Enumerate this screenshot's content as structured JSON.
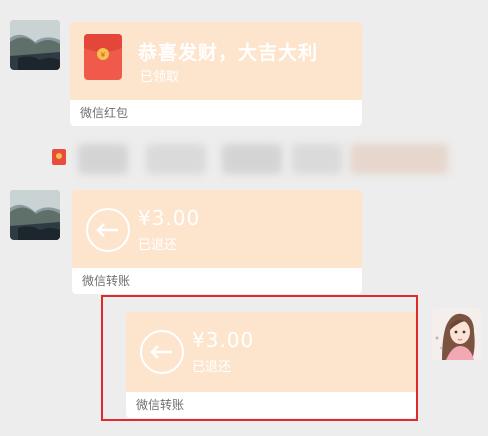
{
  "chat": {
    "red_packet": {
      "title": "恭喜发财，大吉大利",
      "status": "已领取",
      "footer": "微信红包",
      "icon": "red-packet-icon"
    },
    "transfer_received_back": {
      "amount": "¥3.00",
      "status": "已退还",
      "footer": "微信转账",
      "icon": "transfer-return-icon"
    },
    "transfer_sent_back": {
      "amount": "¥3.00",
      "status": "已退还",
      "footer": "微信转账",
      "icon": "transfer-return-icon"
    }
  },
  "colors": {
    "bubble_bg": "#fde5cd",
    "footer_bg": "#ffffff",
    "page_bg": "#ededed",
    "highlight_border": "#e02b2b",
    "red_packet": "#f05a4a"
  }
}
